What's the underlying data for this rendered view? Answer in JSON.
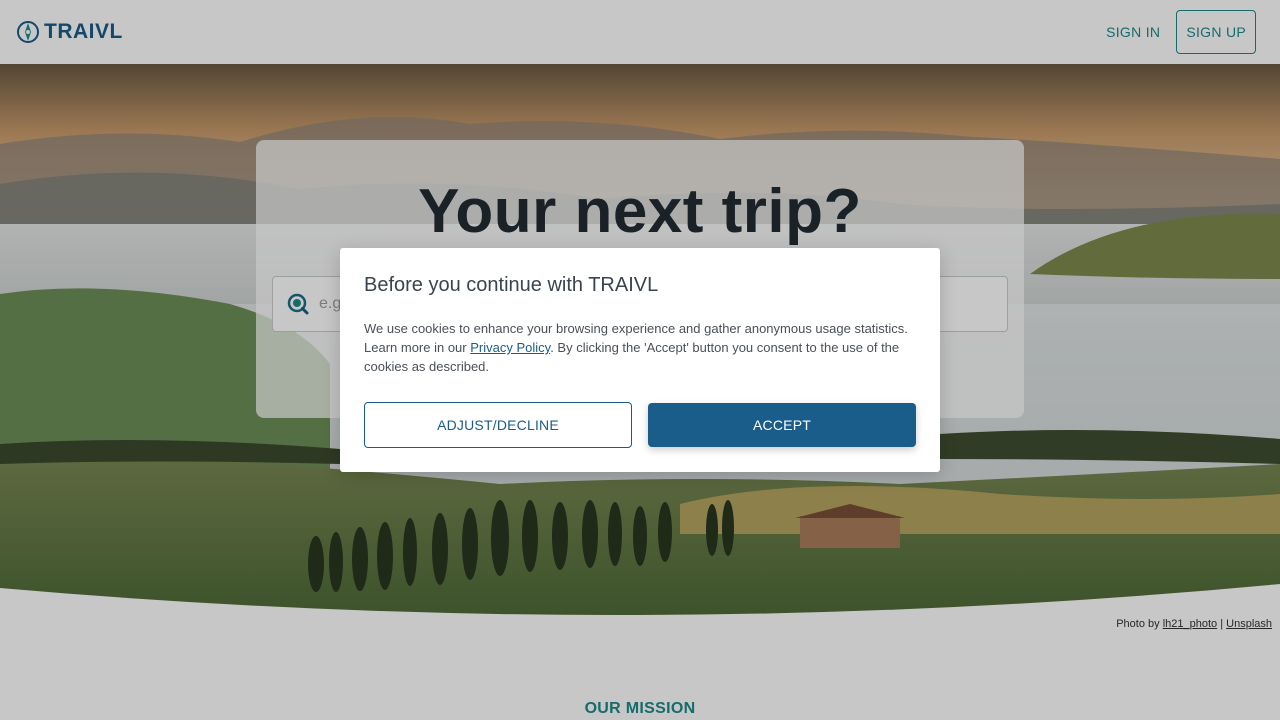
{
  "header": {
    "logo_text": "TRAIVL",
    "sign_in_label": "SIGN IN",
    "sign_up_label": "SIGN UP"
  },
  "hero": {
    "title": "Your next trip?",
    "search_placeholder": "e.g."
  },
  "credit": {
    "prefix": "Photo by",
    "author": "lh21_photo",
    "separator": "|",
    "source": "Unsplash"
  },
  "mission": {
    "heading": "OUR MISSION"
  },
  "cookie_modal": {
    "title": "Before you continue with TRAIVL",
    "text_before_link": "We use cookies to enhance your browsing experience and gather anonymous usage statistics. Learn more in our ",
    "link_label": "Privacy Policy",
    "text_after_link": ". By clicking the 'Accept' button you consent to the use of the cookies as described.",
    "adjust_label": "ADJUST/DECLINE",
    "accept_label": "ACCEPT"
  },
  "colors": {
    "brand": "#1a5d8a",
    "accent": "#1d8a8a"
  },
  "icons": {
    "logo": "compass-icon",
    "search": "search-globe-icon"
  }
}
